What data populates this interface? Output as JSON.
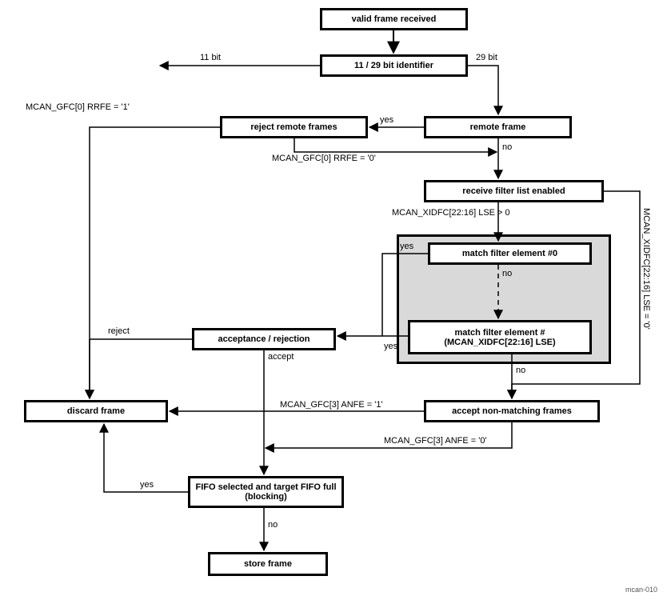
{
  "nodes": {
    "valid_frame": "valid frame received",
    "identifier": "11 / 29 bit identifier",
    "reject_remote": "reject remote frames",
    "remote_frame": "remote frame",
    "recv_filter_enabled": "receive filter list enabled",
    "match_filter_0": "match filter element #0",
    "match_filter_n": "match filter element #(MCAN_XIDFC[22:16] LSE)",
    "acceptance": "acceptance / rejection",
    "accept_nonmatch": "accept non-matching frames",
    "discard": "discard frame",
    "fifo_full": "FIFO selected and target FIFO full (blocking)",
    "store": "store frame"
  },
  "labels": {
    "bit11": "11 bit",
    "bit29": "29 bit",
    "rrfe1": "MCAN_GFC[0] RRFE = '1'",
    "rrfe0": "MCAN_GFC[0] RRFE = '0'",
    "lse_gt0": "MCAN_XIDFC[22:16] LSE > 0",
    "lse_eq0": "MCAN_XIDFC[22:16] LSE = '0'",
    "anfe1": "MCAN_GFC[3] ANFE = '1'",
    "anfe0": "MCAN_GFC[3] ANFE = '0'",
    "yes": "yes",
    "no": "no",
    "reject": "reject",
    "accept": "accept",
    "footer": "mcan-010"
  }
}
